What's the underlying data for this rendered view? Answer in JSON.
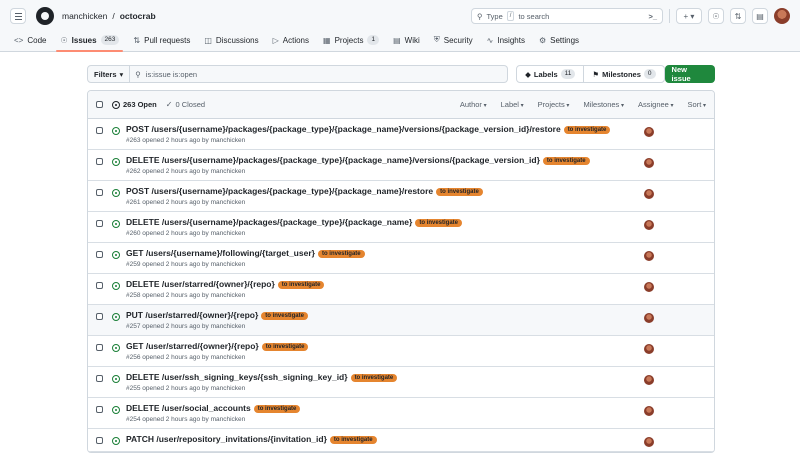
{
  "header": {
    "owner": "manchicken",
    "separator": "/",
    "repo": "octocrab",
    "search_pre": "Type",
    "search_key": "/",
    "search_post": "to search",
    "plus": "+ ▾"
  },
  "nav": {
    "tabs": [
      {
        "label": "Code"
      },
      {
        "label": "Issues",
        "count": "263"
      },
      {
        "label": "Pull requests"
      },
      {
        "label": "Discussions"
      },
      {
        "label": "Actions"
      },
      {
        "label": "Projects",
        "count": "1"
      },
      {
        "label": "Wiki"
      },
      {
        "label": "Security"
      },
      {
        "label": "Insights"
      },
      {
        "label": "Settings"
      }
    ]
  },
  "toolbar": {
    "filters_label": "Filters",
    "query": "is:issue is:open",
    "labels_label": "Labels",
    "labels_count": "11",
    "milestones_label": "Milestones",
    "milestones_count": "0",
    "new_issue_label": "New issue"
  },
  "listhead": {
    "open_label": "263 Open",
    "closed_label": "0 Closed",
    "sorts": [
      "Author",
      "Label",
      "Projects",
      "Milestones",
      "Assignee",
      "Sort"
    ]
  },
  "issues": [
    {
      "title": "POST /users/{username}/packages/{package_type}/{package_name}/versions/{package_version_id}/restore",
      "label": "to investigate",
      "meta": "#263 opened 2 hours ago by manchicken"
    },
    {
      "title": "DELETE /users/{username}/packages/{package_type}/{package_name}/versions/{package_version_id}",
      "label": "to investigate",
      "meta": "#262 opened 2 hours ago by manchicken"
    },
    {
      "title": "POST /users/{username}/packages/{package_type}/{package_name}/restore",
      "label": "to investigate",
      "meta": "#261 opened 2 hours ago by manchicken"
    },
    {
      "title": "DELETE /users/{username}/packages/{package_type}/{package_name}",
      "label": "to investigate",
      "meta": "#260 opened 2 hours ago by manchicken"
    },
    {
      "title": "GET /users/{username}/following/{target_user}",
      "label": "to investigate",
      "meta": "#259 opened 2 hours ago by manchicken"
    },
    {
      "title": "DELETE /user/starred/{owner}/{repo}",
      "label": "to investigate",
      "meta": "#258 opened 2 hours ago by manchicken"
    },
    {
      "title": "PUT /user/starred/{owner}/{repo}",
      "label": "to investigate",
      "meta": "#257 opened 2 hours ago by manchicken"
    },
    {
      "title": "GET /user/starred/{owner}/{repo}",
      "label": "to investigate",
      "meta": "#256 opened 2 hours ago by manchicken"
    },
    {
      "title": "DELETE /user/ssh_signing_keys/{ssh_signing_key_id}",
      "label": "to investigate",
      "meta": "#255 opened 2 hours ago by manchicken"
    },
    {
      "title": "DELETE /user/social_accounts",
      "label": "to investigate",
      "meta": "#254 opened 2 hours ago by manchicken"
    },
    {
      "title": "PATCH /user/repository_invitations/{invitation_id}",
      "label": "to investigate",
      "meta": ""
    }
  ],
  "colors": {
    "label_bg": "#e5852f",
    "new_issue_bg": "#1f883d",
    "open_green": "#1a7f37",
    "tab_underline": "#fd8c73"
  },
  "icons": [
    "menu-icon",
    "github-logo-icon",
    "search-icon",
    "terminal-icon",
    "issue-opened-icon",
    "pull-request-icon",
    "inbox-icon",
    "tag-icon",
    "milestone-icon",
    "check-icon"
  ]
}
